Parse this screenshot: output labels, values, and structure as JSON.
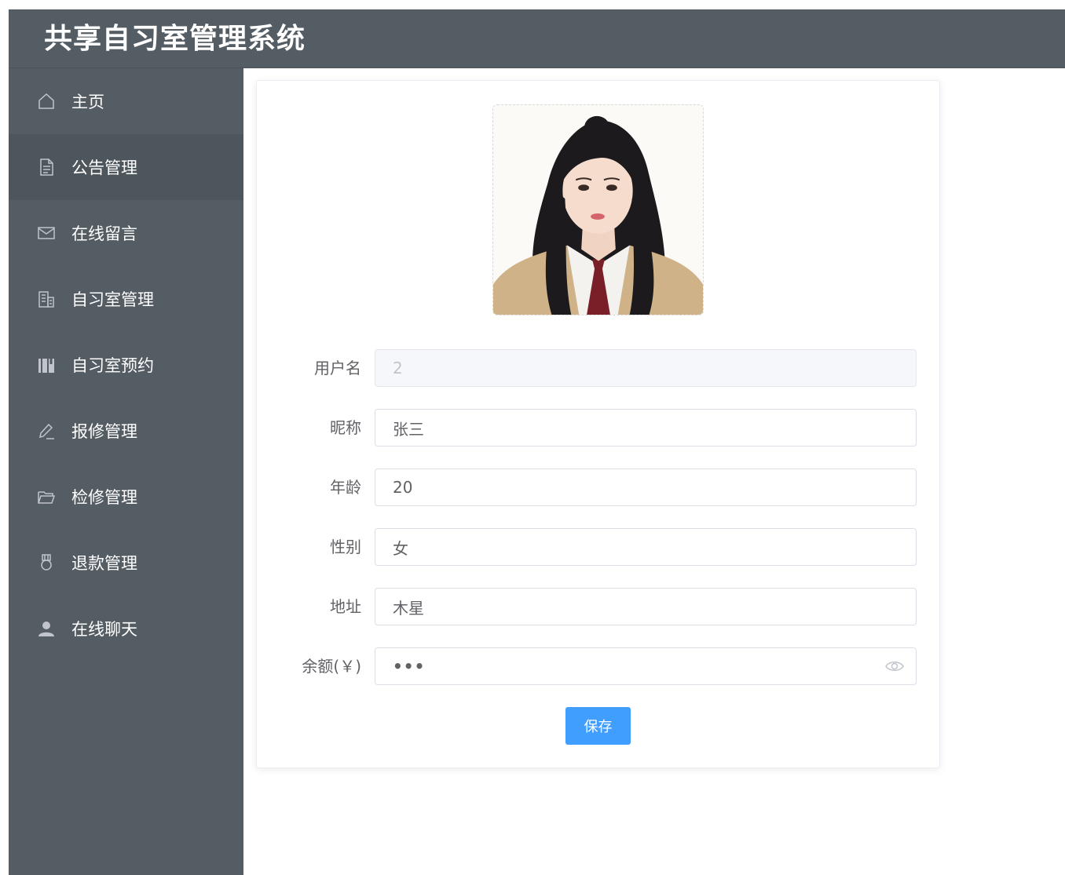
{
  "app": {
    "title": "共享自习室管理系统"
  },
  "sidebar": {
    "items": [
      {
        "label": "主页",
        "icon": "home-icon",
        "active": false
      },
      {
        "label": "公告管理",
        "icon": "document-icon",
        "active": true
      },
      {
        "label": "在线留言",
        "icon": "message-icon",
        "active": false
      },
      {
        "label": "自习室管理",
        "icon": "office-building-icon",
        "active": false
      },
      {
        "label": "自习室预约",
        "icon": "reading-icon",
        "active": false
      },
      {
        "label": "报修管理",
        "icon": "edit-pen-icon",
        "active": false
      },
      {
        "label": "检修管理",
        "icon": "folder-opened-icon",
        "active": false
      },
      {
        "label": "退款管理",
        "icon": "medal-icon",
        "active": false
      },
      {
        "label": "在线聊天",
        "icon": "user-solid-icon",
        "active": false
      }
    ]
  },
  "profile": {
    "avatar_icon": "avatar-photo",
    "fields": {
      "username": {
        "label": "用户名",
        "value": "2"
      },
      "nickname": {
        "label": "昵称",
        "value": "张三"
      },
      "age": {
        "label": "年龄",
        "value": "20"
      },
      "gender": {
        "label": "性别",
        "value": "女"
      },
      "address": {
        "label": "地址",
        "value": "木星"
      },
      "balance": {
        "label": "余额(￥)",
        "value": "•••"
      }
    },
    "save_label": "保存"
  },
  "colors": {
    "sidebar_bg": "#545c64",
    "primary": "#409eff",
    "label": "#606266"
  }
}
